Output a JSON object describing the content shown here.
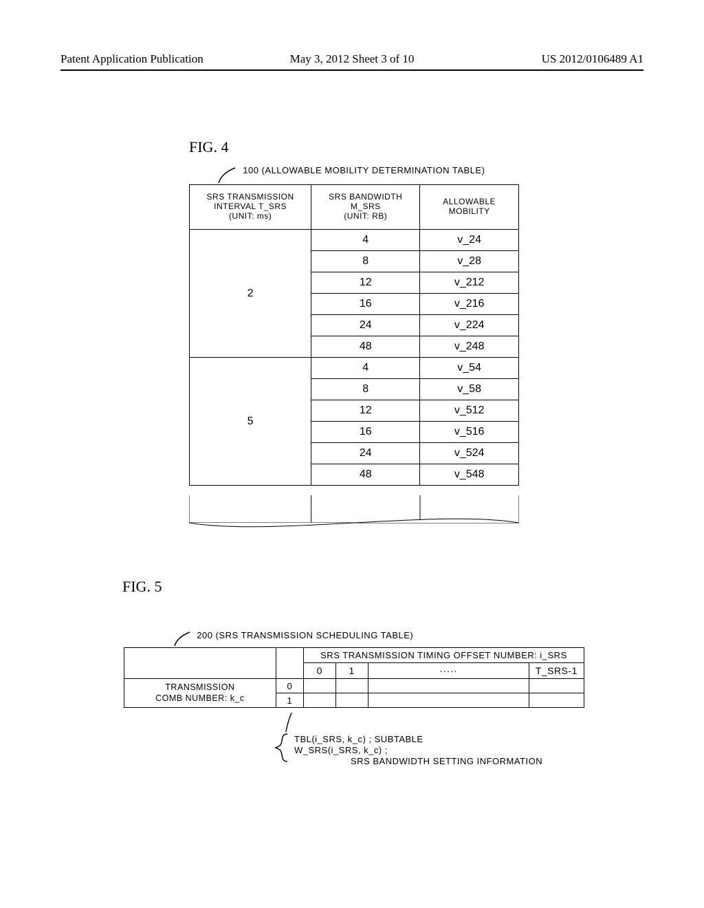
{
  "header": {
    "left": "Patent Application Publication",
    "center": "May 3, 2012   Sheet 3 of 10",
    "right": "US 2012/0106489 A1"
  },
  "fig4": {
    "label": "FIG.  4",
    "table_ref": "100",
    "table_title": "(ALLOWABLE MOBILITY DETERMINATION TABLE)",
    "columns": {
      "interval": "SRS TRANSMISSION\nINTERVAL T_SRS\n(UNIT: ms)",
      "bandwidth": "SRS BANDWIDTH\nM_SRS\n(UNIT: RB)",
      "mobility": "ALLOWABLE\nMOBILITY"
    },
    "groups": [
      {
        "interval": "2",
        "rows": [
          {
            "bw": "4",
            "mob": "v_24"
          },
          {
            "bw": "8",
            "mob": "v_28"
          },
          {
            "bw": "12",
            "mob": "v_212"
          },
          {
            "bw": "16",
            "mob": "v_216"
          },
          {
            "bw": "24",
            "mob": "v_224"
          },
          {
            "bw": "48",
            "mob": "v_248"
          }
        ]
      },
      {
        "interval": "5",
        "rows": [
          {
            "bw": "4",
            "mob": "v_54"
          },
          {
            "bw": "8",
            "mob": "v_58"
          },
          {
            "bw": "12",
            "mob": "v_512"
          },
          {
            "bw": "16",
            "mob": "v_516"
          },
          {
            "bw": "24",
            "mob": "v_524"
          },
          {
            "bw": "48",
            "mob": "v_548"
          }
        ]
      }
    ]
  },
  "fig5": {
    "label": "FIG.  5",
    "table_ref": "200",
    "table_title": "(SRS TRANSMISSION SCHEDULING TABLE)",
    "col_group_label": "SRS TRANSMISSION TIMING OFFSET NUMBER: i_SRS",
    "row_group_label": "TRANSMISSION\nCOMB NUMBER: k_c",
    "col_headers": [
      "0",
      "1",
      "·····",
      "T_SRS-1"
    ],
    "row_headers": [
      "0",
      "1"
    ],
    "annotation": {
      "line1": "TBL(i_SRS, k_c) ; SUBTABLE",
      "line2": "W_SRS(i_SRS, k_c) ;",
      "line3": "SRS BANDWIDTH SETTING INFORMATION"
    }
  }
}
